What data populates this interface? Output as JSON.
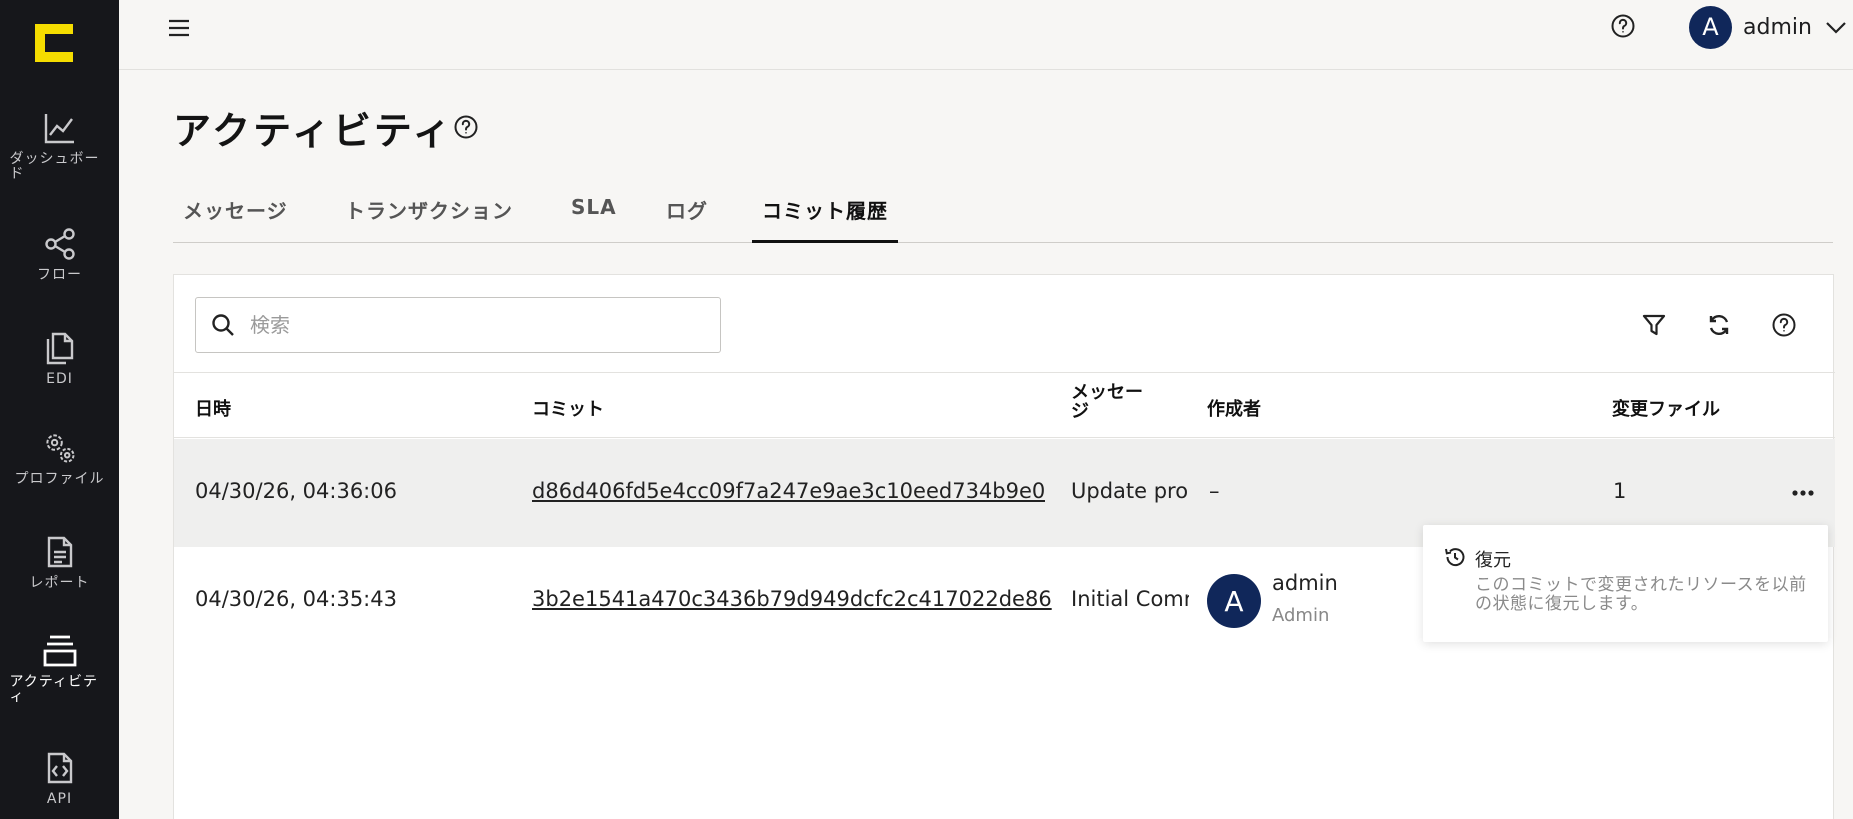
{
  "sidebar": {
    "items": [
      {
        "label": "ダッシュボード"
      },
      {
        "label": "フロー"
      },
      {
        "label": "EDI"
      },
      {
        "label": "プロファイル"
      },
      {
        "label": "レポート"
      },
      {
        "label": "アクティビティ"
      },
      {
        "label": "API"
      }
    ]
  },
  "topbar": {
    "user_initial": "A",
    "user_name": "admin"
  },
  "page": {
    "title": "アクティビティ"
  },
  "tabs": [
    {
      "label": "メッセージ"
    },
    {
      "label": "トランザクション"
    },
    {
      "label": "SLA"
    },
    {
      "label": "ログ"
    },
    {
      "label": "コミット履歴",
      "active": true
    }
  ],
  "search": {
    "placeholder": "検索"
  },
  "table": {
    "headers": [
      "日時",
      "コミット",
      "メッセージ",
      "作成者",
      "変更ファイル"
    ],
    "rows": [
      {
        "datetime": "04/30/26, 04:36:06",
        "commit": "d86d406fd5e4cc09f7a247e9ae3c10eed734b9e0",
        "message": "Update pro",
        "author": "–",
        "files": "1"
      },
      {
        "datetime": "04/30/26, 04:35:43",
        "commit": "3b2e1541a470c3436b79d949dcfc2c417022de86",
        "message": "Initial Comr",
        "author_initial": "A",
        "author_name": "admin",
        "author_role": "Admin"
      }
    ]
  },
  "popup": {
    "title": "復元",
    "description": "このコミットで変更されたリソースを以前の状態に復元します。"
  },
  "colors": {
    "accent": "#f5dd00",
    "sidebar": "#16171b",
    "avatar": "#10275a"
  }
}
